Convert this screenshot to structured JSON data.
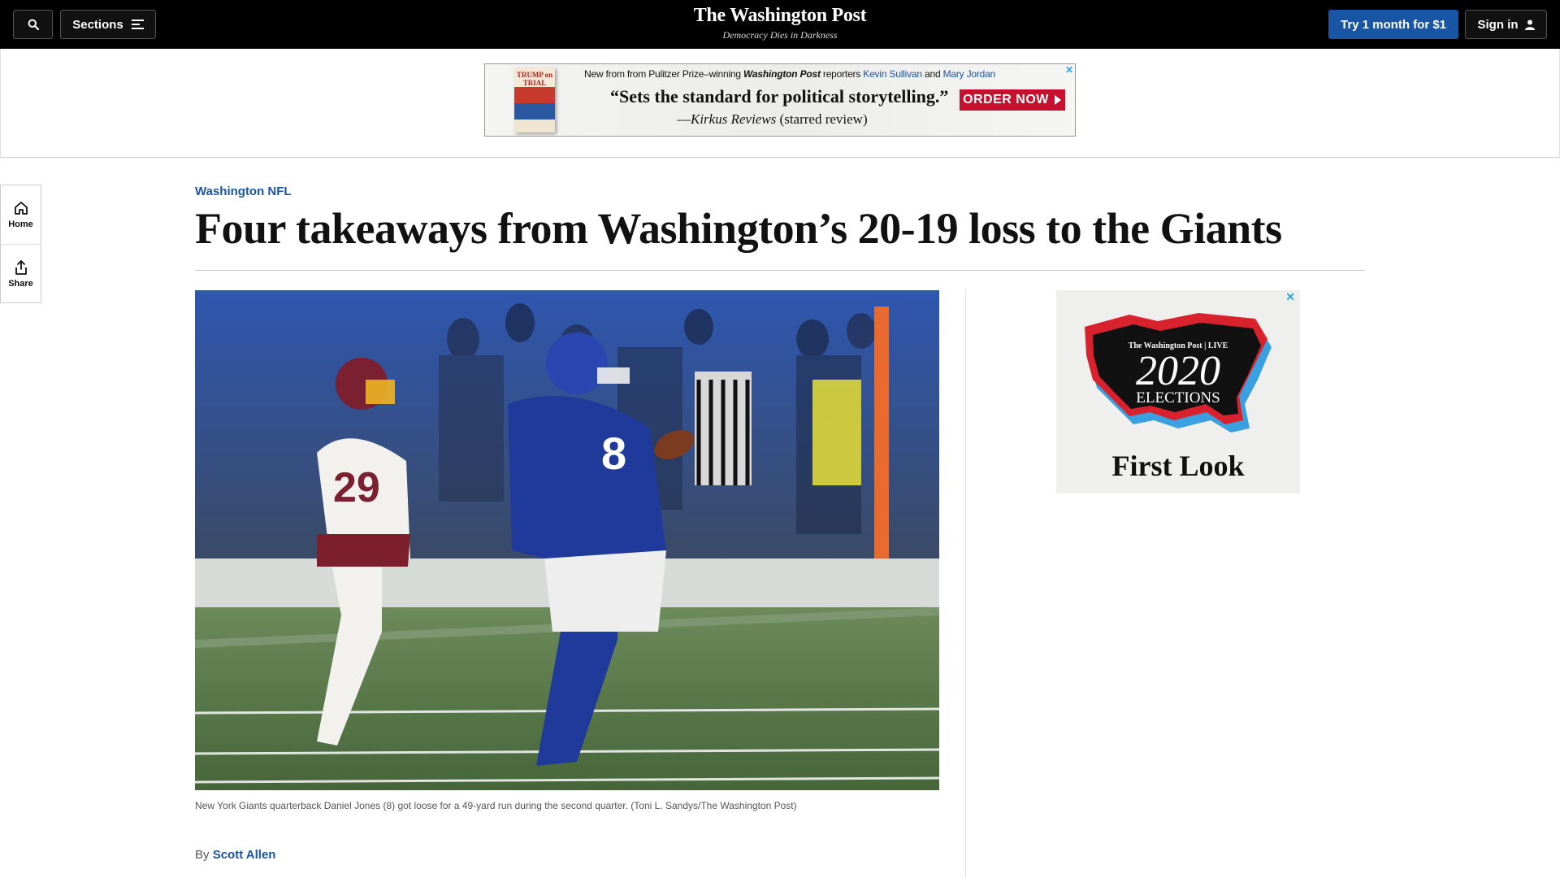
{
  "header": {
    "search_icon": "search-icon",
    "sections_label": "Sections",
    "logo_title": "The Washington Post",
    "logo_tagline": "Democracy Dies in Darkness",
    "trial_label": "Try 1 month for $1",
    "signin_label": "Sign in"
  },
  "top_ad": {
    "book_title": "TRUMP on TRIAL",
    "intro_prefix": "New from from Pulitzer Prize–winning ",
    "intro_paper": "Washington Post",
    "intro_mid": " reporters ",
    "reporter1": "Kevin Sullivan",
    "intro_and": " and ",
    "reporter2": "Mary Jordan",
    "quote": "“Sets the standard for political storytelling.”",
    "attrib_dash": "—",
    "attrib_source": "Kirkus Reviews",
    "attrib_note": " (starred review)",
    "cta": "ORDER NOW",
    "close": "✕"
  },
  "rail": {
    "home_label": "Home",
    "share_label": "Share"
  },
  "article": {
    "kicker": "Washington NFL",
    "headline": "Four takeaways from Washington’s 20-19 loss to the Giants",
    "caption": "New York Giants quarterback Daniel Jones (8) got loose for a 49-yard run during the second quarter. (Toni L. Sandys/The Washington Post)",
    "byline_prefix": "By ",
    "author": "Scott Allen",
    "photo": {
      "jersey_left": "29",
      "jersey_right": "8"
    }
  },
  "side_ad": {
    "close": "✕",
    "brand": "The Washington Post | LIVE",
    "year": "2020",
    "elections": "ELECTIONS",
    "first_look": "First Look"
  },
  "colors": {
    "accent_blue": "#1955a5",
    "nav_black": "#000000",
    "order_red": "#c8102e"
  }
}
